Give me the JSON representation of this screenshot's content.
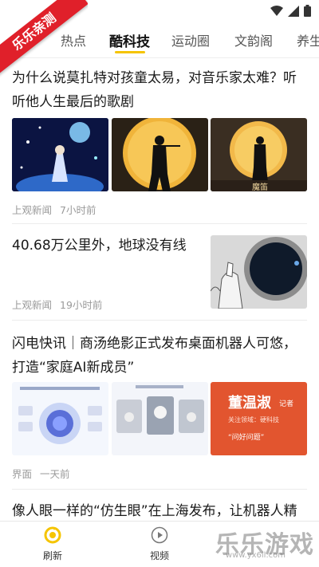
{
  "ribbon": {
    "text": "乐乐亲测"
  },
  "tabs": [
    {
      "label": "热点",
      "active": false
    },
    {
      "label": "酷科技",
      "active": true
    },
    {
      "label": "运动圈",
      "active": false
    },
    {
      "label": "文韵阁",
      "active": false
    },
    {
      "label": "养生",
      "active": false
    }
  ],
  "articles": [
    {
      "title": "为什么说莫扎特对孩童太易，对音乐家太难？听听他人生最后的歌剧",
      "source": "上观新闻",
      "time": "7小时前",
      "images": [
        "opera-stage-image",
        "flute-player-moon-image",
        "magic-flute-poster-image"
      ],
      "image_caption": "魔笛"
    },
    {
      "title": "40.68万公里外，地球没有线",
      "source": "上观新闻",
      "time": "19小时前",
      "images": [
        "astronaut-helmet-image"
      ]
    },
    {
      "title": "闪电快讯｜商汤绝影正式发布桌面机器人可悠，打造“家庭AI新成员”",
      "source": "界面",
      "time": "一天前",
      "images": [
        "robot-diagram-image",
        "robot-photos-image",
        "reporter-card-image"
      ],
      "reporter_card": {
        "name": "董温淑",
        "role": "记者",
        "field": "关注领域：硬科技",
        "button": "“问好问题”"
      }
    },
    {
      "title": "像人眼一样的“仿生眼”在上海发布，让机器人精"
    }
  ],
  "bottom_nav": [
    {
      "label": "刷新",
      "icon": "refresh-icon"
    },
    {
      "label": "视频",
      "icon": "play-icon"
    }
  ],
  "watermark": {
    "text": "乐乐游戏",
    "sub": "www.yx6ll.com"
  }
}
